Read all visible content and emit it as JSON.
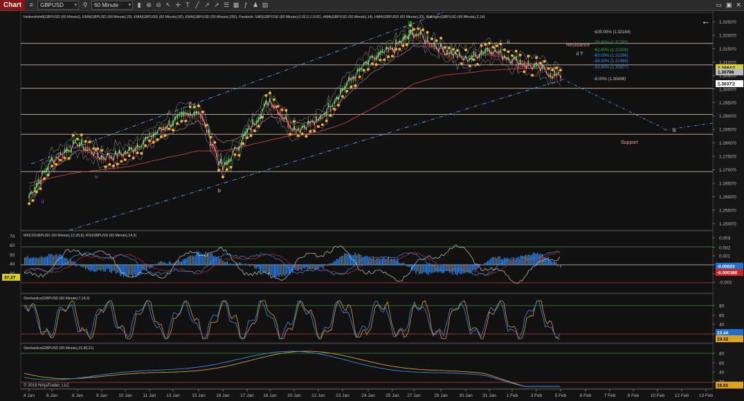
{
  "toolbar": {
    "chart_tab": "Chart",
    "instrument": "GBPUSD",
    "timeframe": "60 Minute",
    "icons": [
      "chart-style-icon",
      "search-icon",
      "zoom-in-icon",
      "zoom-out-icon",
      "pointer-icon",
      "crosshair-icon",
      "text-tool-icon",
      "line-tool-icon",
      "ray-tool-icon",
      "arrow-tool-icon",
      "properties-icon",
      "data-box-icon",
      "indicators-icon",
      "strategies-icon",
      "templates-icon"
    ],
    "window_controls": [
      "▭",
      "▣",
      "✕"
    ]
  },
  "price_panel": {
    "indicator_title": "HeikenAshi8(GBPUSD (60 Minute)), EMA(GBPUSD (60 Minute),20), EMA(GBPUSD (60 Minute),50), EMA(GBPUSD (60 Minute),200), Parabolic SAR(GBPUSD (60 Minute),0.02,0.2,0.02), HMA(GBPUSD (60 Minute),14), HMA(GBPUSD (60 Minute),33), Bollinger(GBPUSD (60 Minute),2,14)",
    "y_ticks": [
      "1.3250'0",
      "1.3200'0",
      "1.3150'0",
      "1.3100'0",
      "1.3050'0",
      "1.3000'0",
      "1.2950'0",
      "1.2900'0",
      "1.2850'0",
      "1.2800'0",
      "1.2750'0",
      "1.2700'0",
      "1.2650'0",
      "1.2600'0",
      "1.2550'0",
      "1.2500'0"
    ],
    "y_range": [
      1.2475,
      1.3285
    ],
    "horizontal_levels": [
      1.317,
      1.309,
      1.3003,
      1.2906,
      1.2832,
      1.2693
    ],
    "price_markers": [
      {
        "label": "1.3084'2",
        "color": "#d8d020",
        "text_color": "#000000",
        "value": 1.3084
      },
      {
        "label": "1.30798",
        "color": "#bbbbbb",
        "text_color": "#000000",
        "value": 1.3074
      },
      {
        "label": "1.3037'2",
        "color": "#ffffff",
        "text_color": "#000000",
        "value": 1.304
      }
    ],
    "fib_levels": [
      {
        "label": "100.00% (1.32184)",
        "color": "#c8c8c8"
      },
      {
        "label": "76.40% (1.31765)",
        "color": "#2fa24a"
      },
      {
        "label": "61.80% (1.31506)",
        "color": "#2fa24a"
      },
      {
        "label": "50.00% (1.31296)",
        "color": "#3a8ee6"
      },
      {
        "label": "38.20% (1.31086)",
        "color": "#3a8ee6"
      },
      {
        "label": "23.60% (1.30827)",
        "color": "#3a8ee6"
      },
      {
        "label": "0.00% (1.30408)",
        "color": "#c8c8c8"
      }
    ],
    "annotations": [
      {
        "text": "Resistance",
        "color": "#d8a0a0"
      },
      {
        "text": "Support",
        "color": "#d8a0a0"
      },
      {
        "text": "ii ?",
        "color": "#dddddd"
      },
      {
        "text": "ii",
        "color": "#dddddd"
      },
      {
        "text": "iii",
        "color": "#dddddd"
      },
      {
        "text": "a",
        "color": "#dddddd"
      },
      {
        "text": "b",
        "color": "#dddddd"
      },
      {
        "text": "c",
        "color": "#dddddd"
      },
      {
        "text": "i",
        "color": "#dddddd"
      },
      {
        "text": "[i]",
        "color": "#2fbf2f"
      },
      {
        "text": "v",
        "color": "#d040d0"
      },
      {
        "text": "iii",
        "color": "#d040d0"
      },
      {
        "text": "iv",
        "color": "#d040d0"
      },
      {
        "text": "ii",
        "color": "#d040d0"
      }
    ]
  },
  "macd_panel": {
    "title": "MACD(GBPUSD (60 Minute),12,26,9), RSI(GBPUSD (60 Minute),14,3)",
    "left_ticks": [
      "70",
      "60",
      "50",
      "40",
      "30"
    ],
    "right_ticks": [
      "0.003",
      "0.002",
      "0.001",
      "0",
      "-0.001",
      "-0.002"
    ],
    "rsi_value": "37.27",
    "macd_values": [
      {
        "label": "-0.00023",
        "color": "#1e6fd0"
      },
      {
        "label": "-0.000386",
        "color": "#d02020"
      }
    ]
  },
  "stoch1_panel": {
    "title": "Stochastics(GBPUSD (60 Minute),7,14,3)",
    "ticks": [
      "80",
      "60",
      "40",
      "20"
    ],
    "values": [
      {
        "label": "23.44",
        "color": "#1e6fd0"
      },
      {
        "label": "10.32",
        "color": "#e0a020"
      }
    ]
  },
  "stoch2_panel": {
    "title": "Stochastics(GBPUSD (60 Minute),21,89,21)",
    "ticks": [
      "80",
      "60",
      "40",
      "20"
    ],
    "values": [
      {
        "label": "15.61",
        "color": "#e0a020"
      }
    ],
    "copyright": "© 2019 NinjaTrader, LLC"
  },
  "x_axis": {
    "labels": [
      "4 Jan",
      "6 Jan",
      "8 Jan",
      "9 Jan",
      "10 Jan",
      "11 Jan",
      "13 Jan",
      "15 Jan",
      "16 Jan",
      "17 Jan",
      "18 Jan",
      "20 Jan",
      "22 Jan",
      "23 Jan",
      "24 Jan",
      "25 Jan",
      "27 Jan",
      "29 Jan",
      "30 Jan",
      "31 Jan",
      "1 Feb",
      "3 Feb",
      "5 Feb",
      "6 Feb",
      "7 Feb",
      "8 Feb",
      "10 Feb",
      "12 Feb",
      "13 Feb"
    ]
  },
  "chart_data": {
    "type": "line",
    "x": [
      "4 Jan",
      "6 Jan",
      "8 Jan",
      "9 Jan",
      "10 Jan",
      "11 Jan",
      "13 Jan",
      "15 Jan",
      "16 Jan",
      "17 Jan",
      "18 Jan",
      "20 Jan",
      "22 Jan",
      "23 Jan",
      "24 Jan",
      "25 Jan",
      "27 Jan",
      "29 Jan",
      "30 Jan",
      "31 Jan",
      "1 Feb",
      "3 Feb",
      "5 Feb"
    ],
    "series": [
      {
        "values": [
          1.26,
          1.2735,
          1.28,
          1.2745,
          1.276,
          1.282,
          1.288,
          1.292,
          1.27,
          1.284,
          1.296,
          1.285,
          1.288,
          1.3,
          1.31,
          1.315,
          1.321,
          1.315,
          1.311,
          1.315,
          1.311,
          1.308,
          1.3045
        ]
      },
      {
        "values": [
          1.258,
          1.27,
          1.277,
          1.276,
          1.276,
          1.279,
          1.284,
          1.288,
          1.28,
          1.283,
          1.29,
          1.287,
          1.288,
          1.296,
          1.305,
          1.311,
          1.316,
          1.315,
          1.312,
          1.313,
          1.311,
          1.309,
          1.307
        ]
      },
      {
        "values": [
          1.265,
          1.267,
          1.269,
          1.27,
          1.271,
          1.273,
          1.275,
          1.277,
          1.277,
          1.279,
          1.281,
          1.283,
          1.284,
          1.287,
          1.292,
          1.297,
          1.302,
          1.305,
          1.306,
          1.307,
          1.3075,
          1.3078,
          1.308
        ]
      }
    ],
    "ylim": [
      1.2475,
      1.3285
    ],
    "grid": false
  }
}
